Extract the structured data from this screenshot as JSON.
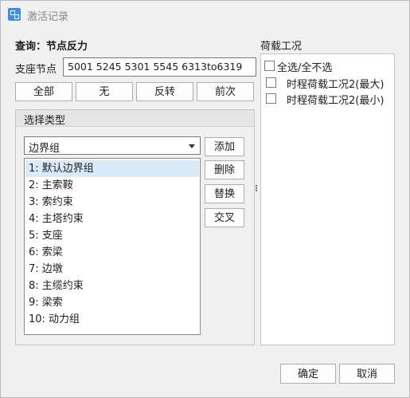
{
  "window": {
    "title": "激活记录"
  },
  "query": {
    "label": "查询：节点反力"
  },
  "support": {
    "label": "支座节点",
    "value": "5001 5245 5301 5545 6313to6319"
  },
  "selection_buttons": {
    "all": "全部",
    "none": "无",
    "invert": "反转",
    "previous": "前次"
  },
  "type_group": {
    "header": "选择类型",
    "combo_value": "边界组",
    "items": [
      "1: 默认边界组",
      "2: 主索鞍",
      "3: 索约束",
      "4: 主塔约束",
      "5: 支座",
      "6: 索梁",
      "7: 边墩",
      "8: 主缆约束",
      "9: 梁索",
      "10: 动力组"
    ],
    "selected_index": 0,
    "buttons": {
      "add": "添加",
      "delete": "删除",
      "replace": "替换",
      "intersect": "交叉"
    }
  },
  "load_cases": {
    "label": "荷载工况",
    "select_all": "全选/全不选",
    "items": [
      "时程荷载工况2(最大)",
      "时程荷载工况2(最小)"
    ]
  },
  "footer": {
    "ok": "确定",
    "cancel": "取消"
  }
}
